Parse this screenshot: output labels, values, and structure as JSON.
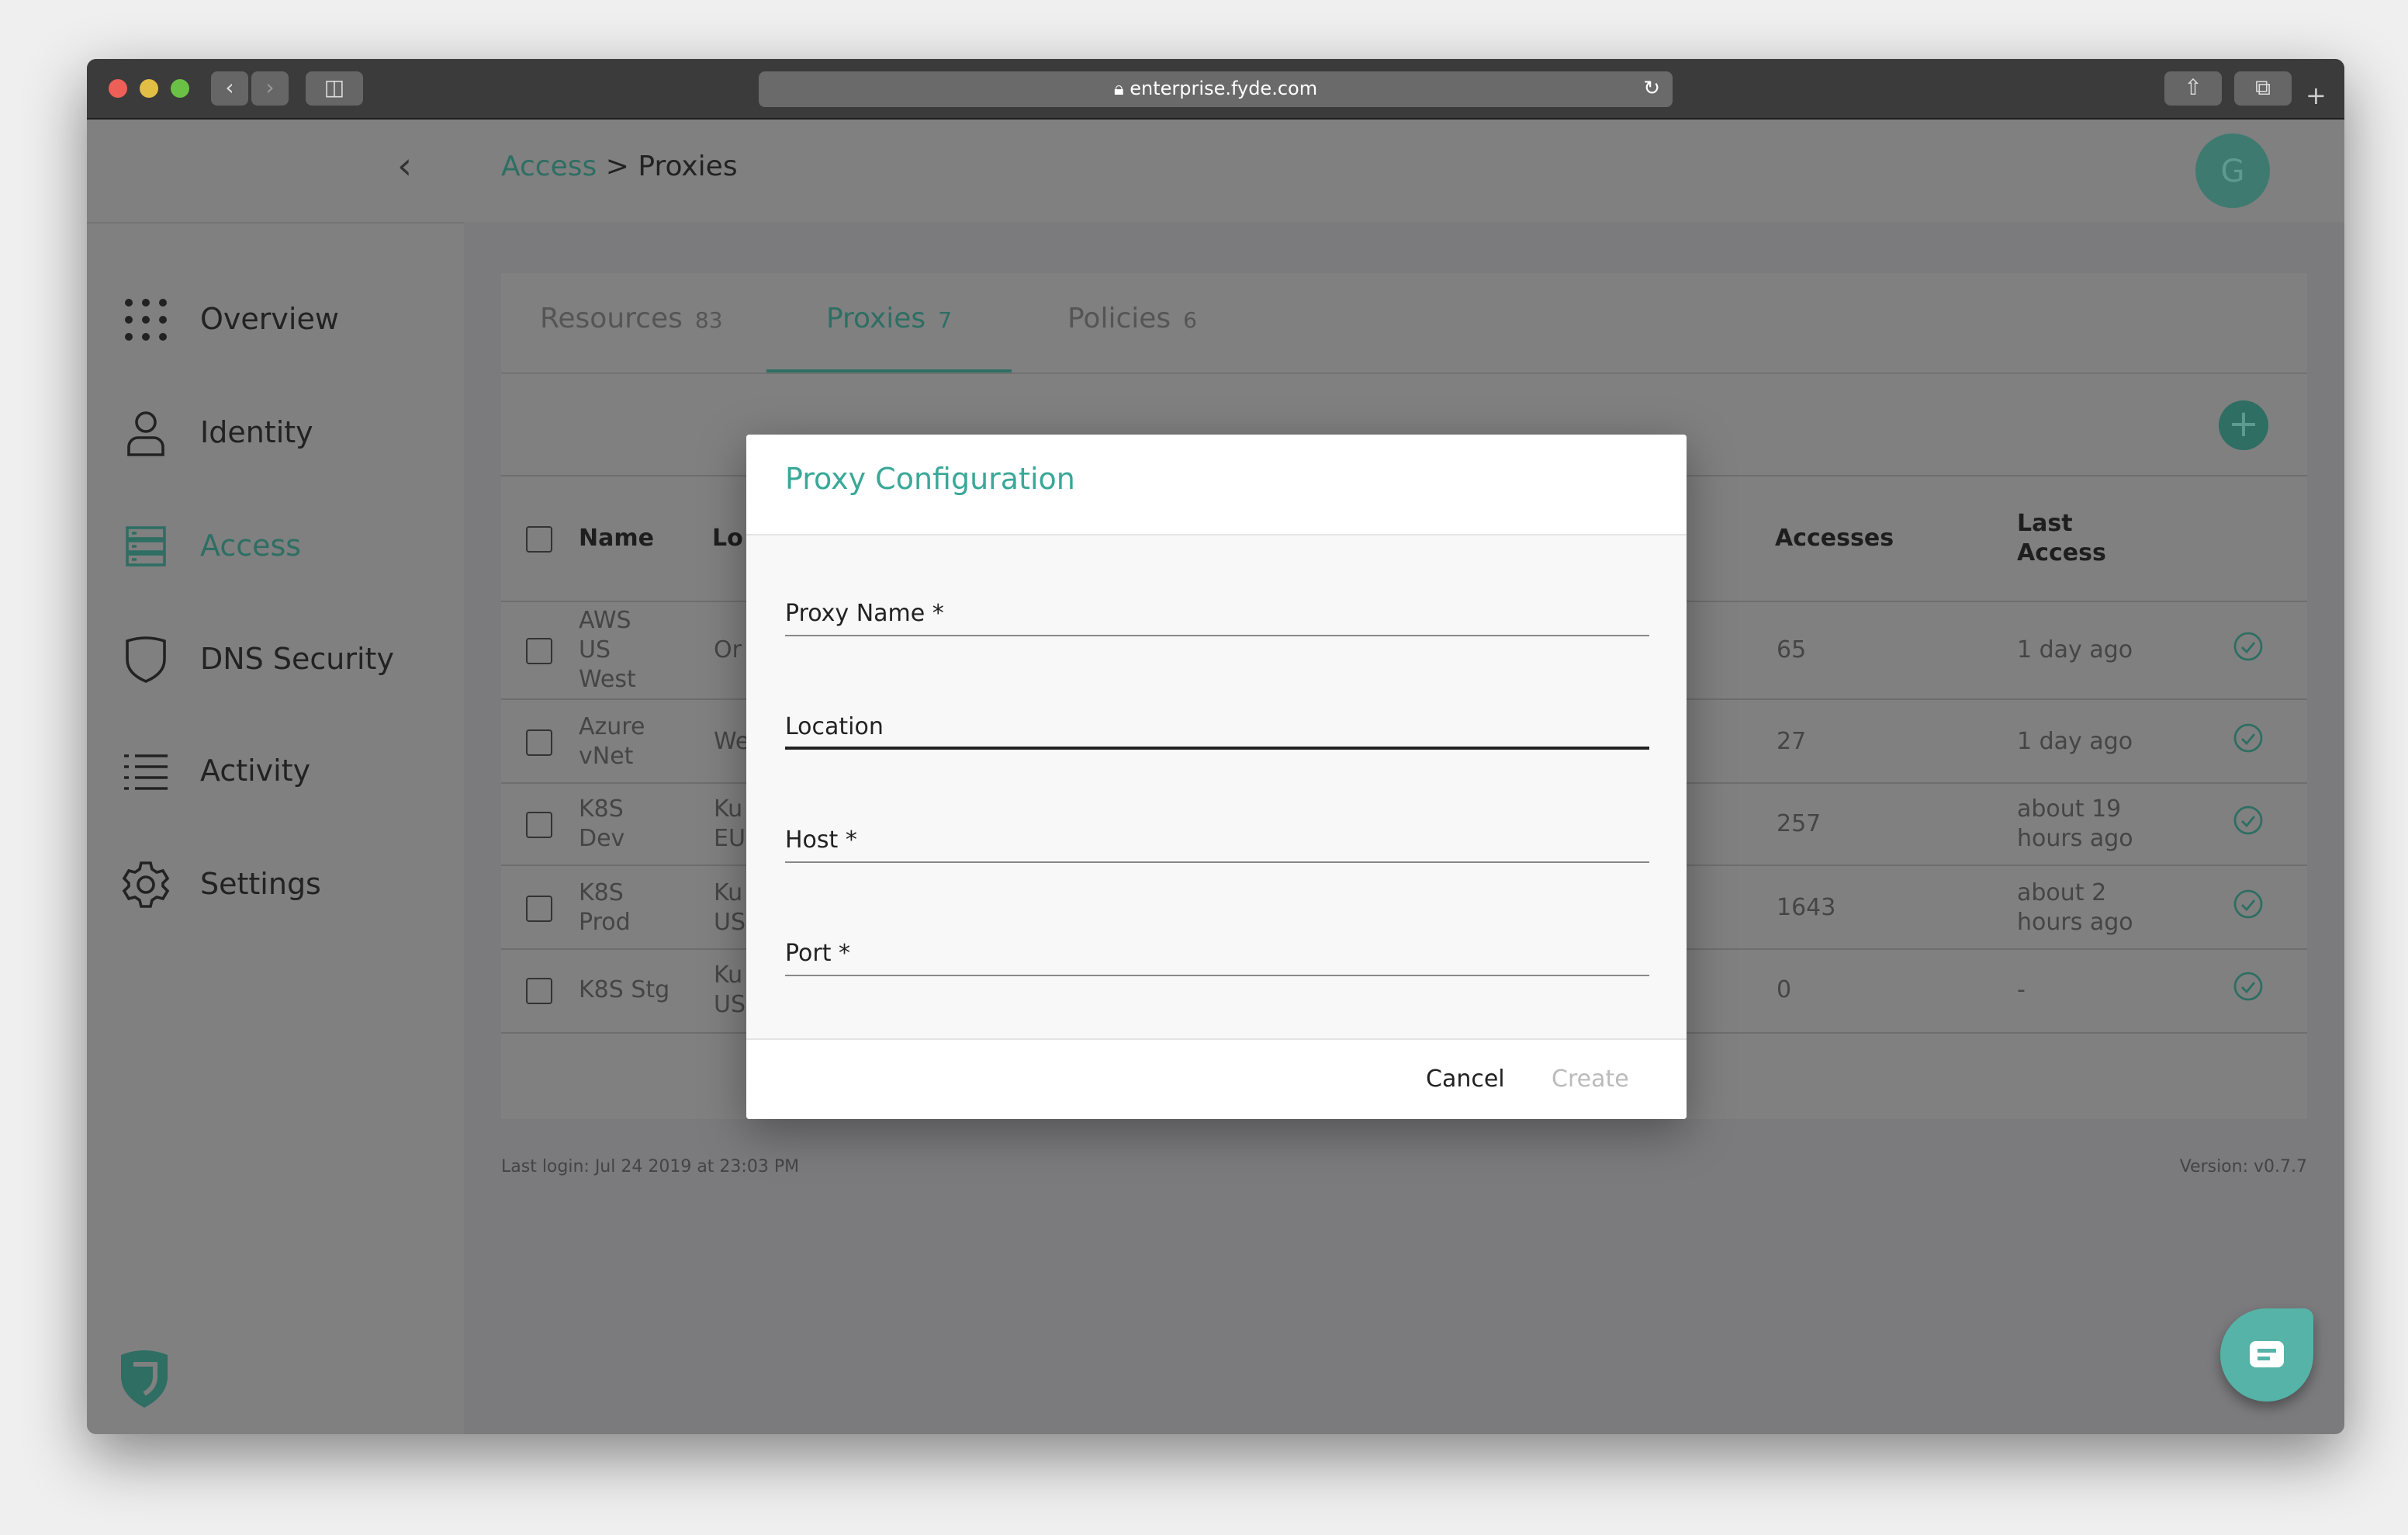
{
  "browser": {
    "url": "enterprise.fyde.com",
    "icons": [
      "back-icon",
      "forward-icon",
      "sidebar-icon",
      "lock-icon",
      "reload-icon",
      "share-icon",
      "tabs-icon",
      "new-tab-icon"
    ]
  },
  "header": {
    "breadcrumb_parent": "Access",
    "breadcrumb_separator": ">",
    "breadcrumb_current": "Proxies",
    "avatar_initial": "G"
  },
  "sidebar": {
    "items": [
      {
        "label": "Overview",
        "icon": "grid-dots-icon"
      },
      {
        "label": "Identity",
        "icon": "user-icon"
      },
      {
        "label": "Access",
        "icon": "server-icon",
        "active": true
      },
      {
        "label": "DNS Security",
        "icon": "shield-icon"
      },
      {
        "label": "Activity",
        "icon": "list-icon"
      },
      {
        "label": "Settings",
        "icon": "gear-icon"
      }
    ]
  },
  "tabs": [
    {
      "label": "Resources",
      "count": "83"
    },
    {
      "label": "Proxies",
      "count": "7",
      "active": true
    },
    {
      "label": "Policies",
      "count": "6"
    }
  ],
  "table": {
    "headers": {
      "name": "Name",
      "location": "Lo",
      "accesses": "Accesses",
      "last_access_1": "Last",
      "last_access_2": "Access"
    },
    "rows": [
      {
        "name": [
          "AWS",
          "US",
          "West"
        ],
        "location": [
          "Or"
        ],
        "accesses": "65",
        "last": [
          "1 day ago"
        ]
      },
      {
        "name": [
          "Azure",
          "vNet"
        ],
        "location": [
          "We"
        ],
        "accesses": "27",
        "last": [
          "1 day ago"
        ]
      },
      {
        "name": [
          "K8S",
          "Dev"
        ],
        "location": [
          "Ku",
          "EU"
        ],
        "accesses": "257",
        "last": [
          "about 19",
          "hours ago"
        ]
      },
      {
        "name": [
          "K8S",
          "Prod"
        ],
        "location": [
          "Ku",
          "US"
        ],
        "accesses": "1643",
        "last": [
          "about 2",
          "hours ago"
        ]
      },
      {
        "name": [
          "K8S Stg"
        ],
        "location": [
          "Ku",
          "US"
        ],
        "accesses": "0",
        "last": [
          "-"
        ]
      }
    ]
  },
  "footer": {
    "last_login": "Last login: Jul 24 2019 at 23:03 PM",
    "version": "Version: v0.7.7"
  },
  "modal": {
    "title": "Proxy Configuration",
    "fields": [
      {
        "label": "Proxy Name *"
      },
      {
        "label": "Location",
        "focused": true
      },
      {
        "label": "Host *"
      },
      {
        "label": "Port *"
      }
    ],
    "cancel": "Cancel",
    "create": "Create"
  },
  "colors": {
    "accent": "#3aa898",
    "chat": "#55b3a8"
  }
}
